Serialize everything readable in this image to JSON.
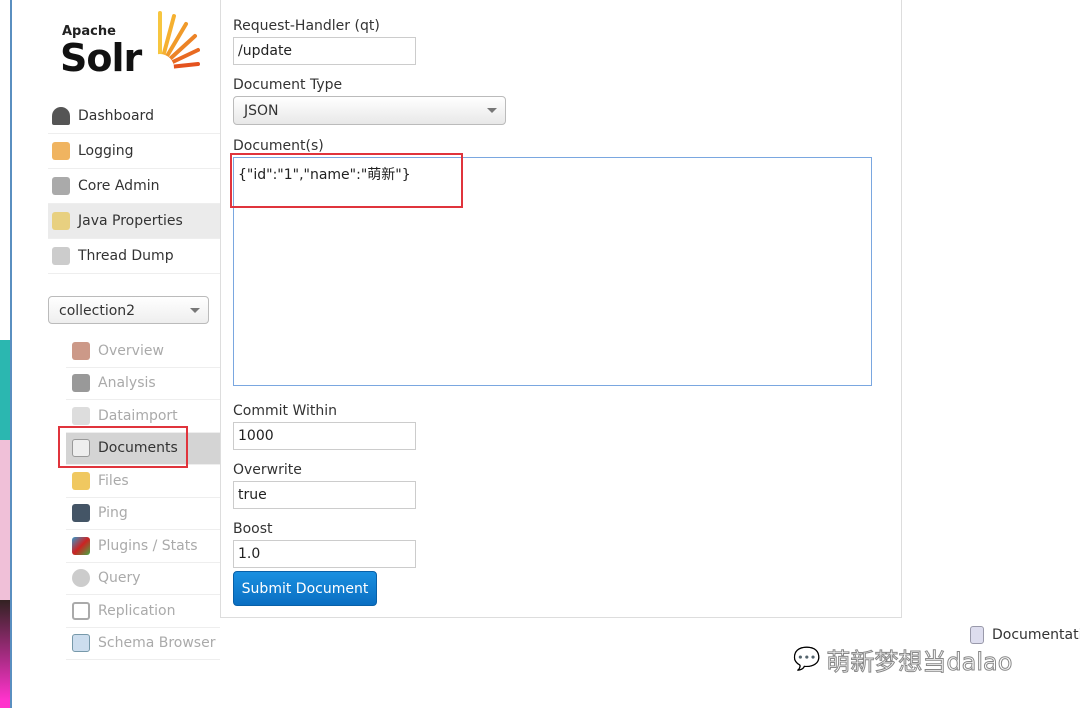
{
  "logo": {
    "apache": "Apache",
    "solr": "Solr"
  },
  "nav": [
    {
      "label": "Dashboard",
      "icon": "dashboard-icon"
    },
    {
      "label": "Logging",
      "icon": "logging-icon"
    },
    {
      "label": "Core Admin",
      "icon": "core-admin-icon"
    },
    {
      "label": "Java Properties",
      "icon": "java-properties-icon",
      "selected": true
    },
    {
      "label": "Thread Dump",
      "icon": "thread-dump-icon"
    }
  ],
  "core_selector": "collection2",
  "core_menu": [
    {
      "label": "Overview"
    },
    {
      "label": "Analysis"
    },
    {
      "label": "Dataimport"
    },
    {
      "label": "Documents",
      "active": true
    },
    {
      "label": "Files"
    },
    {
      "label": "Ping"
    },
    {
      "label": "Plugins / Stats"
    },
    {
      "label": "Query"
    },
    {
      "label": "Replication"
    },
    {
      "label": "Schema Browser"
    }
  ],
  "form": {
    "handler_label": "Request-Handler (qt)",
    "handler_value": "/update",
    "doctype_label": "Document Type",
    "doctype_value": "JSON",
    "docs_label": "Document(s)",
    "docs_value": "{\"id\":\"1\",\"name\":\"萌新\"}",
    "commit_label": "Commit Within",
    "commit_value": "1000",
    "overwrite_label": "Overwrite",
    "overwrite_value": "true",
    "boost_label": "Boost",
    "boost_value": "1.0",
    "submit": "Submit Document"
  },
  "footer": {
    "documentation": "Documentati"
  },
  "watermark": "萌新梦想当dalao",
  "colors": {
    "highlight": "#e0343c",
    "accent": "#0a6fc2"
  }
}
